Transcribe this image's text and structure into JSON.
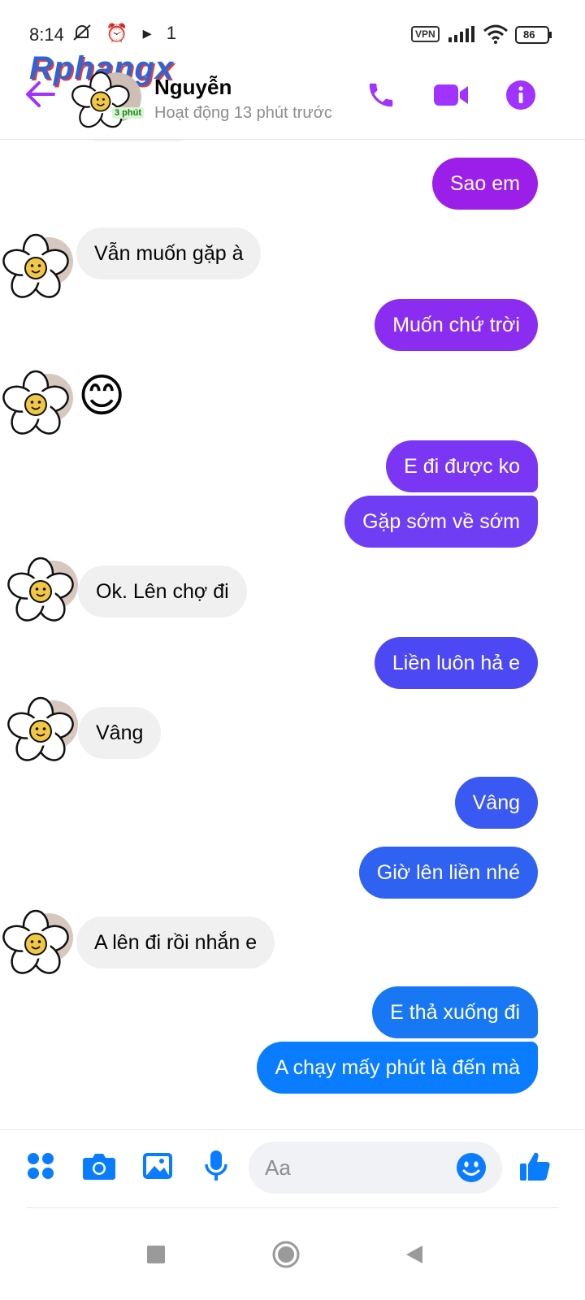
{
  "status_bar": {
    "time": "8:14",
    "left_icons": "⏰ ▸ 1",
    "vpn_label": "VPN",
    "battery": "86"
  },
  "header": {
    "watermark": "Rphangx",
    "contact_name": "Nguyễn",
    "mini_badge": "3 phút",
    "status": "Hoạt động 13 phút trước",
    "accent_color": "#a033ff"
  },
  "messages": [
    {
      "side": "out",
      "text": "Sao em",
      "color": "#9b1fe8"
    },
    {
      "side": "in",
      "text": "Vẫn muốn gặp à"
    },
    {
      "side": "out",
      "text": "Muốn chứ trời",
      "color": "#8a2df0"
    },
    {
      "side": "in",
      "text": "😊",
      "type": "emoji"
    },
    {
      "side": "out",
      "text": "E đi được ko",
      "color": "#7a36f2"
    },
    {
      "side": "out",
      "text": "Gặp sớm về sớm",
      "color": "#6f3ef4"
    },
    {
      "side": "in",
      "text": "Ok. Lên chợ đi"
    },
    {
      "side": "out",
      "text": "Liền luôn hả e",
      "color": "#4c48f4"
    },
    {
      "side": "in",
      "text": "Vâng"
    },
    {
      "side": "out",
      "text": "Vâng",
      "color": "#3a58f2"
    },
    {
      "side": "out",
      "text": "Giờ lên liền nhé",
      "color": "#2f62f0"
    },
    {
      "side": "in",
      "text": "A lên đi rồi nhắn e"
    },
    {
      "side": "out",
      "text": "E thả xuống đi",
      "color": "#1877f2"
    },
    {
      "side": "out",
      "text": "A chạy mấy phút là đến mà",
      "color": "#0a7cff"
    }
  ],
  "composer": {
    "placeholder": "Aa",
    "accent_color": "#0a7cff",
    "icons": [
      "apps-icon",
      "camera-icon",
      "gallery-icon",
      "microphone-icon",
      "emoji-icon",
      "like-icon"
    ]
  },
  "navbar": {
    "icons": [
      "recents-icon",
      "home-icon",
      "back-icon"
    ]
  }
}
